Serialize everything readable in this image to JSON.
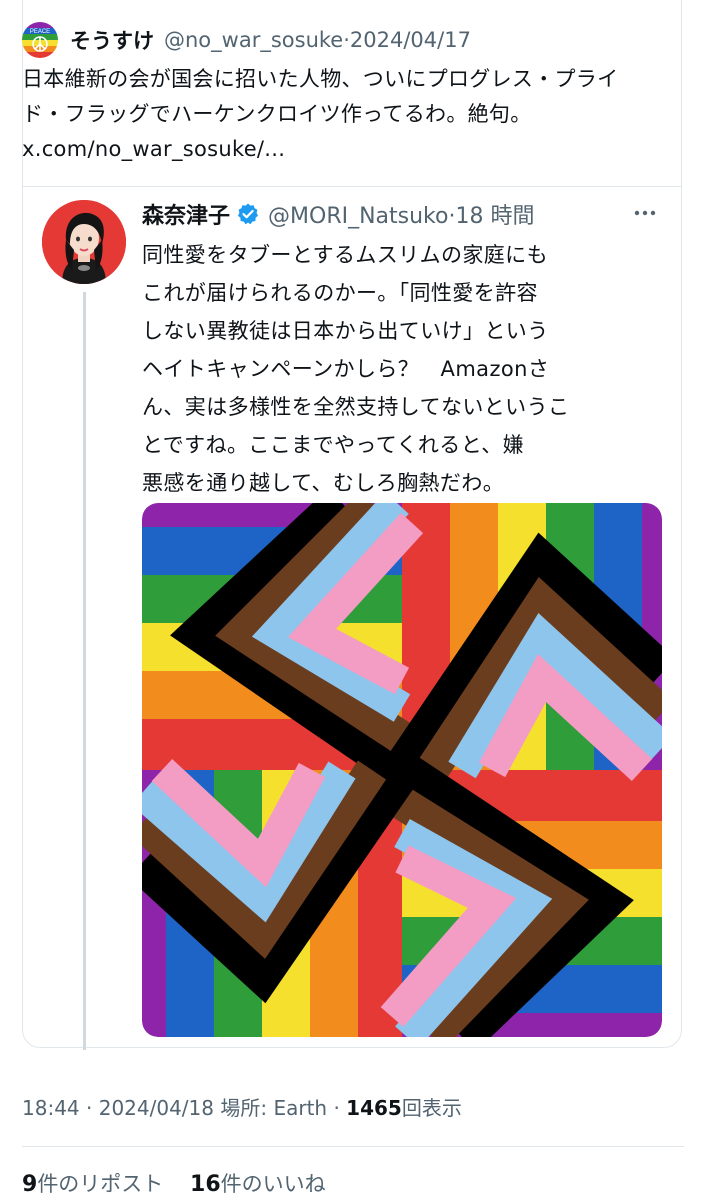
{
  "outer_tweet": {
    "author_name": "そうすけ",
    "handle": "@no_war_sosuke",
    "separator": "·",
    "date": "2024/04/17",
    "avatar_text": "PEACE",
    "text": "日本維新の会が国会に招いた人物、ついにプログレス・プライド・フラッグでハーケンクロイツ作ってるわ。絶句。 ",
    "link": "x.com/no_war_sosuke/..."
  },
  "quoted_tweet": {
    "author_name": "森奈津子",
    "handle": "@MORI_Natsuko",
    "separator": "·",
    "time_ago": "18 時間",
    "lines": [
      "同性愛をタブーとするムスリムの家庭にも",
      "これが届けられるのかー。「同性愛を許容",
      "しない異教徒は日本から出ていけ」という",
      "ヘイトキャンペーンかしら？　Amazonさ",
      "ん、実は多様性を全然支持してないというこ",
      "とですね。ここまでやってくれると、嫌",
      "悪感を通り越して、むしろ胸熱だわ。"
    ]
  },
  "meta": {
    "time": "18:44",
    "separator": "·",
    "date": "2024/04/18",
    "location": "場所: Earth",
    "views_count": "1465",
    "views_label": "回表示"
  },
  "stats": {
    "reposts_count": "9",
    "reposts_label": "件のリポスト",
    "likes_count": "16",
    "likes_label": "件のいいね"
  },
  "colors": {
    "text": "#0f1419",
    "muted": "#536471",
    "verified": "#1d9bf0",
    "border": "#e1e6ea"
  }
}
